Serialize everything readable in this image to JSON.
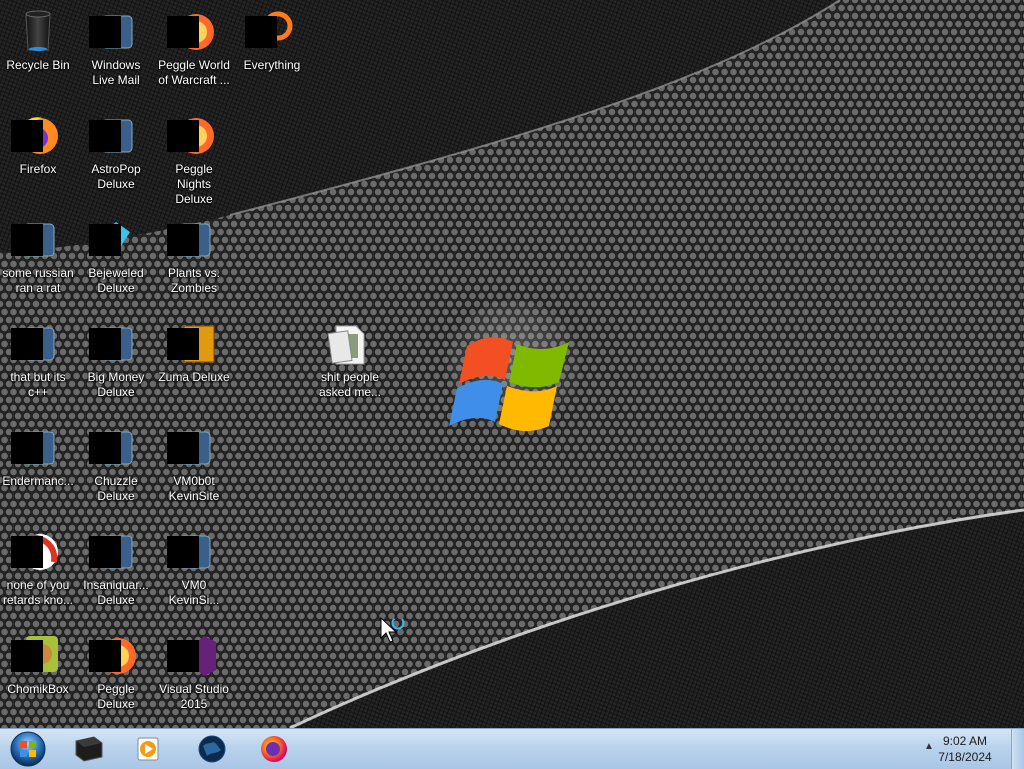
{
  "desktop": {
    "icons": [
      {
        "id": "recycle-bin",
        "label": "Recycle Bin",
        "col": 0,
        "row": 0,
        "icon": "recycle-bin-icon",
        "redacted": false
      },
      {
        "id": "windows-live-mail",
        "label": "Windows Live Mail",
        "col": 1,
        "row": 0,
        "icon": "mail-icon",
        "redacted": true
      },
      {
        "id": "peggle-world-of-warcraft",
        "label": "Peggle World of Warcraft ...",
        "col": 2,
        "row": 0,
        "icon": "peggle-icon",
        "redacted": true
      },
      {
        "id": "everything",
        "label": "Everything",
        "col": 3,
        "row": 0,
        "icon": "search-icon",
        "redacted": true
      },
      {
        "id": "firefox",
        "label": "Firefox",
        "col": 0,
        "row": 1,
        "icon": "firefox-icon",
        "redacted": true
      },
      {
        "id": "astropop-deluxe",
        "label": "AstroPop Deluxe",
        "col": 1,
        "row": 1,
        "icon": "astropop-icon",
        "redacted": true
      },
      {
        "id": "peggle-nights-deluxe",
        "label": "Peggle Nights Deluxe",
        "col": 2,
        "row": 1,
        "icon": "peggle-icon",
        "redacted": true
      },
      {
        "id": "some-russian-ran-a-rat",
        "label": "some russian ran a rat",
        "col": 0,
        "row": 2,
        "icon": "document-icon",
        "redacted": true
      },
      {
        "id": "bejeweled-deluxe",
        "label": "Bejeweled Deluxe",
        "col": 1,
        "row": 2,
        "icon": "gem-icon",
        "redacted": true
      },
      {
        "id": "plants-vs-zombies",
        "label": "Plants vs. Zombies",
        "col": 2,
        "row": 2,
        "icon": "flower-icon",
        "redacted": true
      },
      {
        "id": "that-but-its-cpp",
        "label": "that but its c++",
        "col": 0,
        "row": 3,
        "icon": "files-icon",
        "redacted": true
      },
      {
        "id": "big-money-deluxe",
        "label": "Big Money Deluxe",
        "col": 1,
        "row": 3,
        "icon": "money-icon",
        "redacted": true
      },
      {
        "id": "zuma-deluxe",
        "label": "Zuma Deluxe",
        "col": 2,
        "row": 3,
        "icon": "zuma-icon",
        "redacted": true
      },
      {
        "id": "shit-people-asked-me",
        "label": "shit people asked me...",
        "col": 4,
        "row": 3,
        "icon": "folder-icon",
        "redacted": false
      },
      {
        "id": "endermanch",
        "label": "Endermanc...",
        "col": 0,
        "row": 4,
        "icon": "terminal-icon",
        "redacted": true
      },
      {
        "id": "chuzzle-deluxe",
        "label": "Chuzzle Deluxe",
        "col": 1,
        "row": 4,
        "icon": "chuzzle-icon",
        "redacted": true
      },
      {
        "id": "vm0b0t-kevinsite",
        "label": "VM0b0t KevinSite",
        "col": 2,
        "row": 4,
        "icon": "vm-icon",
        "redacted": true
      },
      {
        "id": "none-of-you-retards",
        "label": "none of you retards kno...",
        "col": 0,
        "row": 5,
        "icon": "ball-icon",
        "redacted": true
      },
      {
        "id": "insaniquarium-deluxe",
        "label": "Insaniquar... Deluxe",
        "col": 1,
        "row": 5,
        "icon": "fish-icon",
        "redacted": true
      },
      {
        "id": "vm0-kevinsite",
        "label": "VM0 KevinSi...",
        "col": 2,
        "row": 5,
        "icon": "vm-icon",
        "redacted": true
      },
      {
        "id": "chomikbox",
        "label": "ChomikBox",
        "col": 0,
        "row": 6,
        "icon": "hamster-icon",
        "redacted": true
      },
      {
        "id": "peggle-deluxe",
        "label": "Peggle Deluxe",
        "col": 1,
        "row": 6,
        "icon": "peggle-icon",
        "redacted": true
      },
      {
        "id": "visual-studio-2015",
        "label": "Visual Studio 2015",
        "col": 2,
        "row": 6,
        "icon": "visual-studio-icon",
        "redacted": true
      }
    ]
  },
  "taskbar": {
    "start": {
      "icon": "windows-orb-icon"
    },
    "pinned": [
      {
        "id": "taskbar-item-1",
        "icon": "monitor-icon"
      },
      {
        "id": "taskbar-item-2",
        "icon": "media-player-icon"
      },
      {
        "id": "taskbar-item-3",
        "icon": "globe-icon"
      },
      {
        "id": "taskbar-item-4",
        "icon": "firefox-icon"
      }
    ],
    "tray": {
      "expand_icon": "▲"
    },
    "clock": {
      "time": "9:02 AM",
      "date": "7/18/2024"
    }
  }
}
